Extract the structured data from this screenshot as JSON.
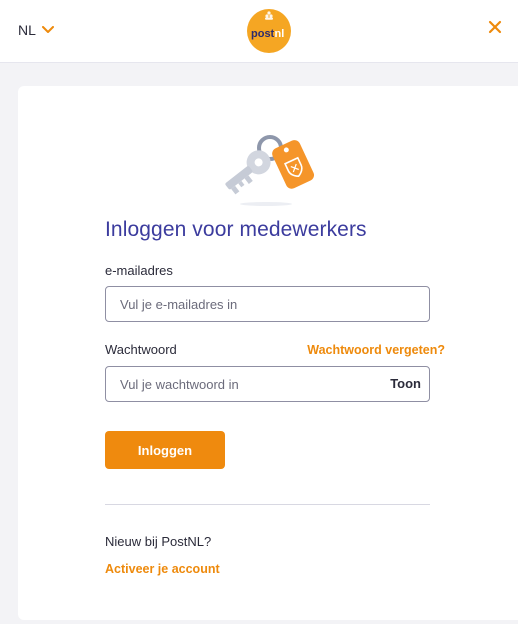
{
  "header": {
    "language": "NL",
    "logo_text": "post",
    "logo_text_accent": "nl",
    "colors": {
      "logo_bg": "#f5a623",
      "accent": "#ee8a0c"
    }
  },
  "login": {
    "title": "Inloggen voor medewerkers",
    "email_label": "e-mailadres",
    "email_placeholder": "Vul je e-mailadres in",
    "password_label": "Wachtwoord",
    "forgot_link": "Wachtwoord vergeten?",
    "password_placeholder": "Vul je wachtwoord in",
    "show_password": "Toon",
    "submit_label": "Inloggen",
    "new_text": "Nieuw bij PostNL?",
    "activate_link": "Activeer je account"
  },
  "colors": {
    "title": "#3c3c9e",
    "primary_button": "#ef8a0e",
    "link": "#ee8a0c"
  }
}
